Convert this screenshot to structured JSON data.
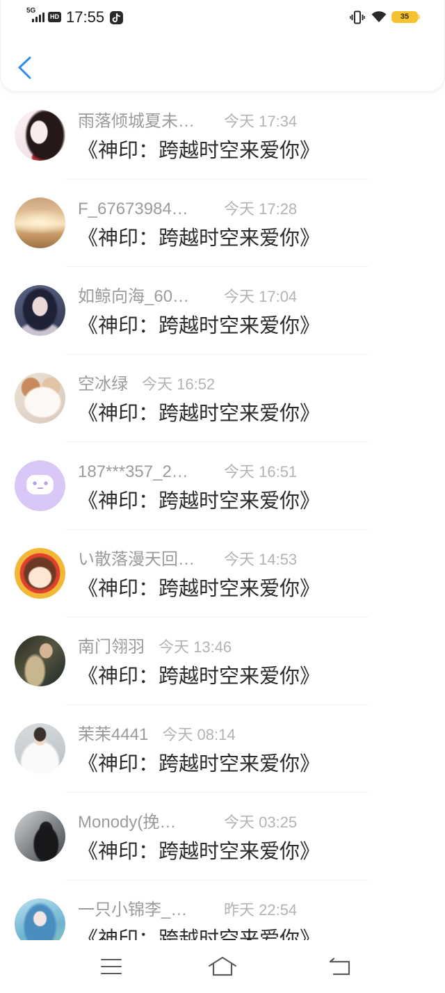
{
  "status_bar": {
    "network_label": "5G",
    "hd_label": "HD",
    "time": "17:55",
    "battery_level": "35",
    "icons": [
      "signal-icon",
      "tiktok-icon",
      "vibrate-icon",
      "wifi-icon",
      "battery-icon"
    ]
  },
  "header": {
    "back_icon": "chevron-left-icon"
  },
  "list": {
    "items": [
      {
        "name": "雨落倾城夏未…",
        "time": "今天 17:34",
        "title": "《神印：跨越时空来爱你》"
      },
      {
        "name": "F_67673984…",
        "time": "今天 17:28",
        "title": "《神印：跨越时空来爱你》"
      },
      {
        "name": "如鲸向海_60…",
        "time": "今天 17:04",
        "title": "《神印：跨越时空来爱你》"
      },
      {
        "name": "空冰绿",
        "time": "今天 16:52",
        "title": "《神印：跨越时空来爱你》"
      },
      {
        "name": "187***357_2…",
        "time": "今天 16:51",
        "title": "《神印：跨越时空来爱你》"
      },
      {
        "name": "い散落漫天回…",
        "time": "今天 14:53",
        "title": "《神印：跨越时空来爱你》"
      },
      {
        "name": "南门翎羽",
        "time": "今天 13:46",
        "title": "《神印：跨越时空来爱你》"
      },
      {
        "name": "茉茉4441",
        "time": "今天 08:14",
        "title": "《神印：跨越时空来爱你》"
      },
      {
        "name": "Monody(挽…",
        "time": "今天 03:25",
        "title": "《神印：跨越时空来爱你》"
      },
      {
        "name": "一只小锦李_…",
        "time": "昨天 22:54",
        "title": "《神印：跨越时空来爱你》"
      }
    ]
  },
  "nav_bar": {
    "icons": [
      "menu-icon",
      "home-icon",
      "return-icon"
    ]
  },
  "colors": {
    "accent": "#2d8cf0",
    "name_text": "#9b9b9b",
    "time_text": "#b3b3b3",
    "title_text": "#2b2b2b",
    "battery": "#f5c12e",
    "default_avatar": "#d9c8f7"
  }
}
